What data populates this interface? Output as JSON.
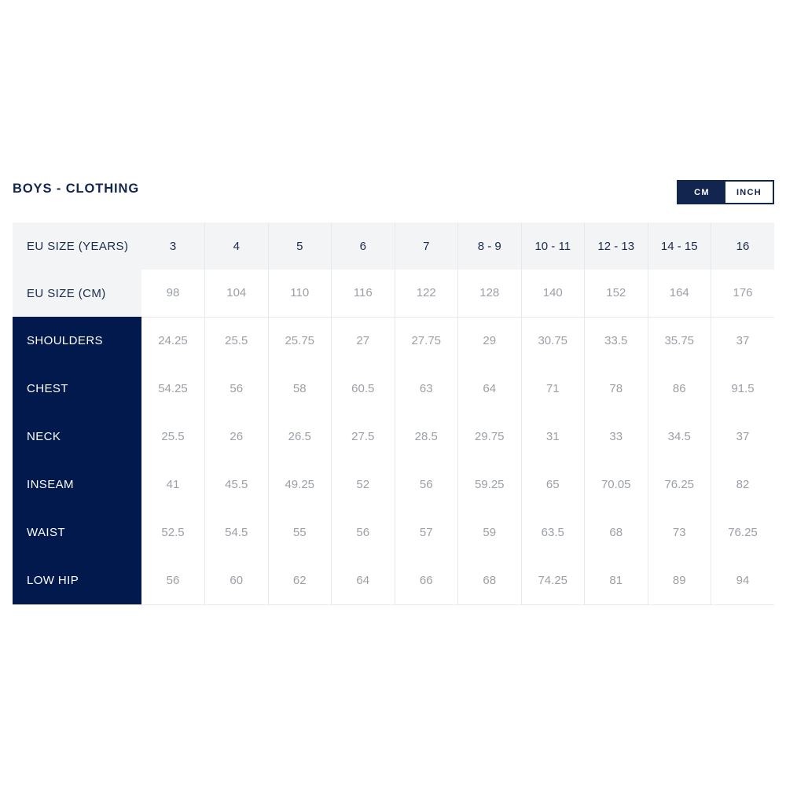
{
  "title": "BOYS - CLOTHING",
  "unit_toggle": {
    "options": [
      {
        "label": "CM",
        "active": true
      },
      {
        "label": "INCH",
        "active": false
      }
    ],
    "selected": "CM"
  },
  "colors": {
    "navy": "#01194c",
    "title_navy": "#12254f",
    "header_bg": "#f3f4f6",
    "value_text": "#9b9fa6",
    "grid_line": "#e6e8eb",
    "page_bg": "#ffffff"
  },
  "chart_data": {
    "type": "table",
    "title": "BOYS - CLOTHING",
    "unit": "CM",
    "header_rows": [
      {
        "label": "EU SIZE (YEARS)",
        "values": [
          "3",
          "4",
          "5",
          "6",
          "7",
          "8 - 9",
          "10 - 11",
          "12 - 13",
          "14 - 15",
          "16"
        ]
      },
      {
        "label": "EU SIZE (CM)",
        "values": [
          "98",
          "104",
          "110",
          "116",
          "122",
          "128",
          "140",
          "152",
          "164",
          "176"
        ]
      }
    ],
    "categories": [
      "3",
      "4",
      "5",
      "6",
      "7",
      "8 - 9",
      "10 - 11",
      "12 - 13",
      "14 - 15",
      "16"
    ],
    "rows": [
      {
        "label": "SHOULDERS",
        "values": [
          "24.25",
          "25.5",
          "25.75",
          "27",
          "27.75",
          "29",
          "30.75",
          "33.5",
          "35.75",
          "37"
        ]
      },
      {
        "label": "CHEST",
        "values": [
          "54.25",
          "56",
          "58",
          "60.5",
          "63",
          "64",
          "71",
          "78",
          "86",
          "91.5"
        ]
      },
      {
        "label": "NECK",
        "values": [
          "25.5",
          "26",
          "26.5",
          "27.5",
          "28.5",
          "29.75",
          "31",
          "33",
          "34.5",
          "37"
        ]
      },
      {
        "label": "INSEAM",
        "values": [
          "41",
          "45.5",
          "49.25",
          "52",
          "56",
          "59.25",
          "65",
          "70.05",
          "76.25",
          "82"
        ]
      },
      {
        "label": "WAIST",
        "values": [
          "52.5",
          "54.5",
          "55",
          "56",
          "57",
          "59",
          "63.5",
          "68",
          "73",
          "76.25"
        ]
      },
      {
        "label": "LOW HIP",
        "values": [
          "56",
          "60",
          "62",
          "64",
          "66",
          "68",
          "74.25",
          "81",
          "89",
          "94"
        ]
      }
    ]
  }
}
